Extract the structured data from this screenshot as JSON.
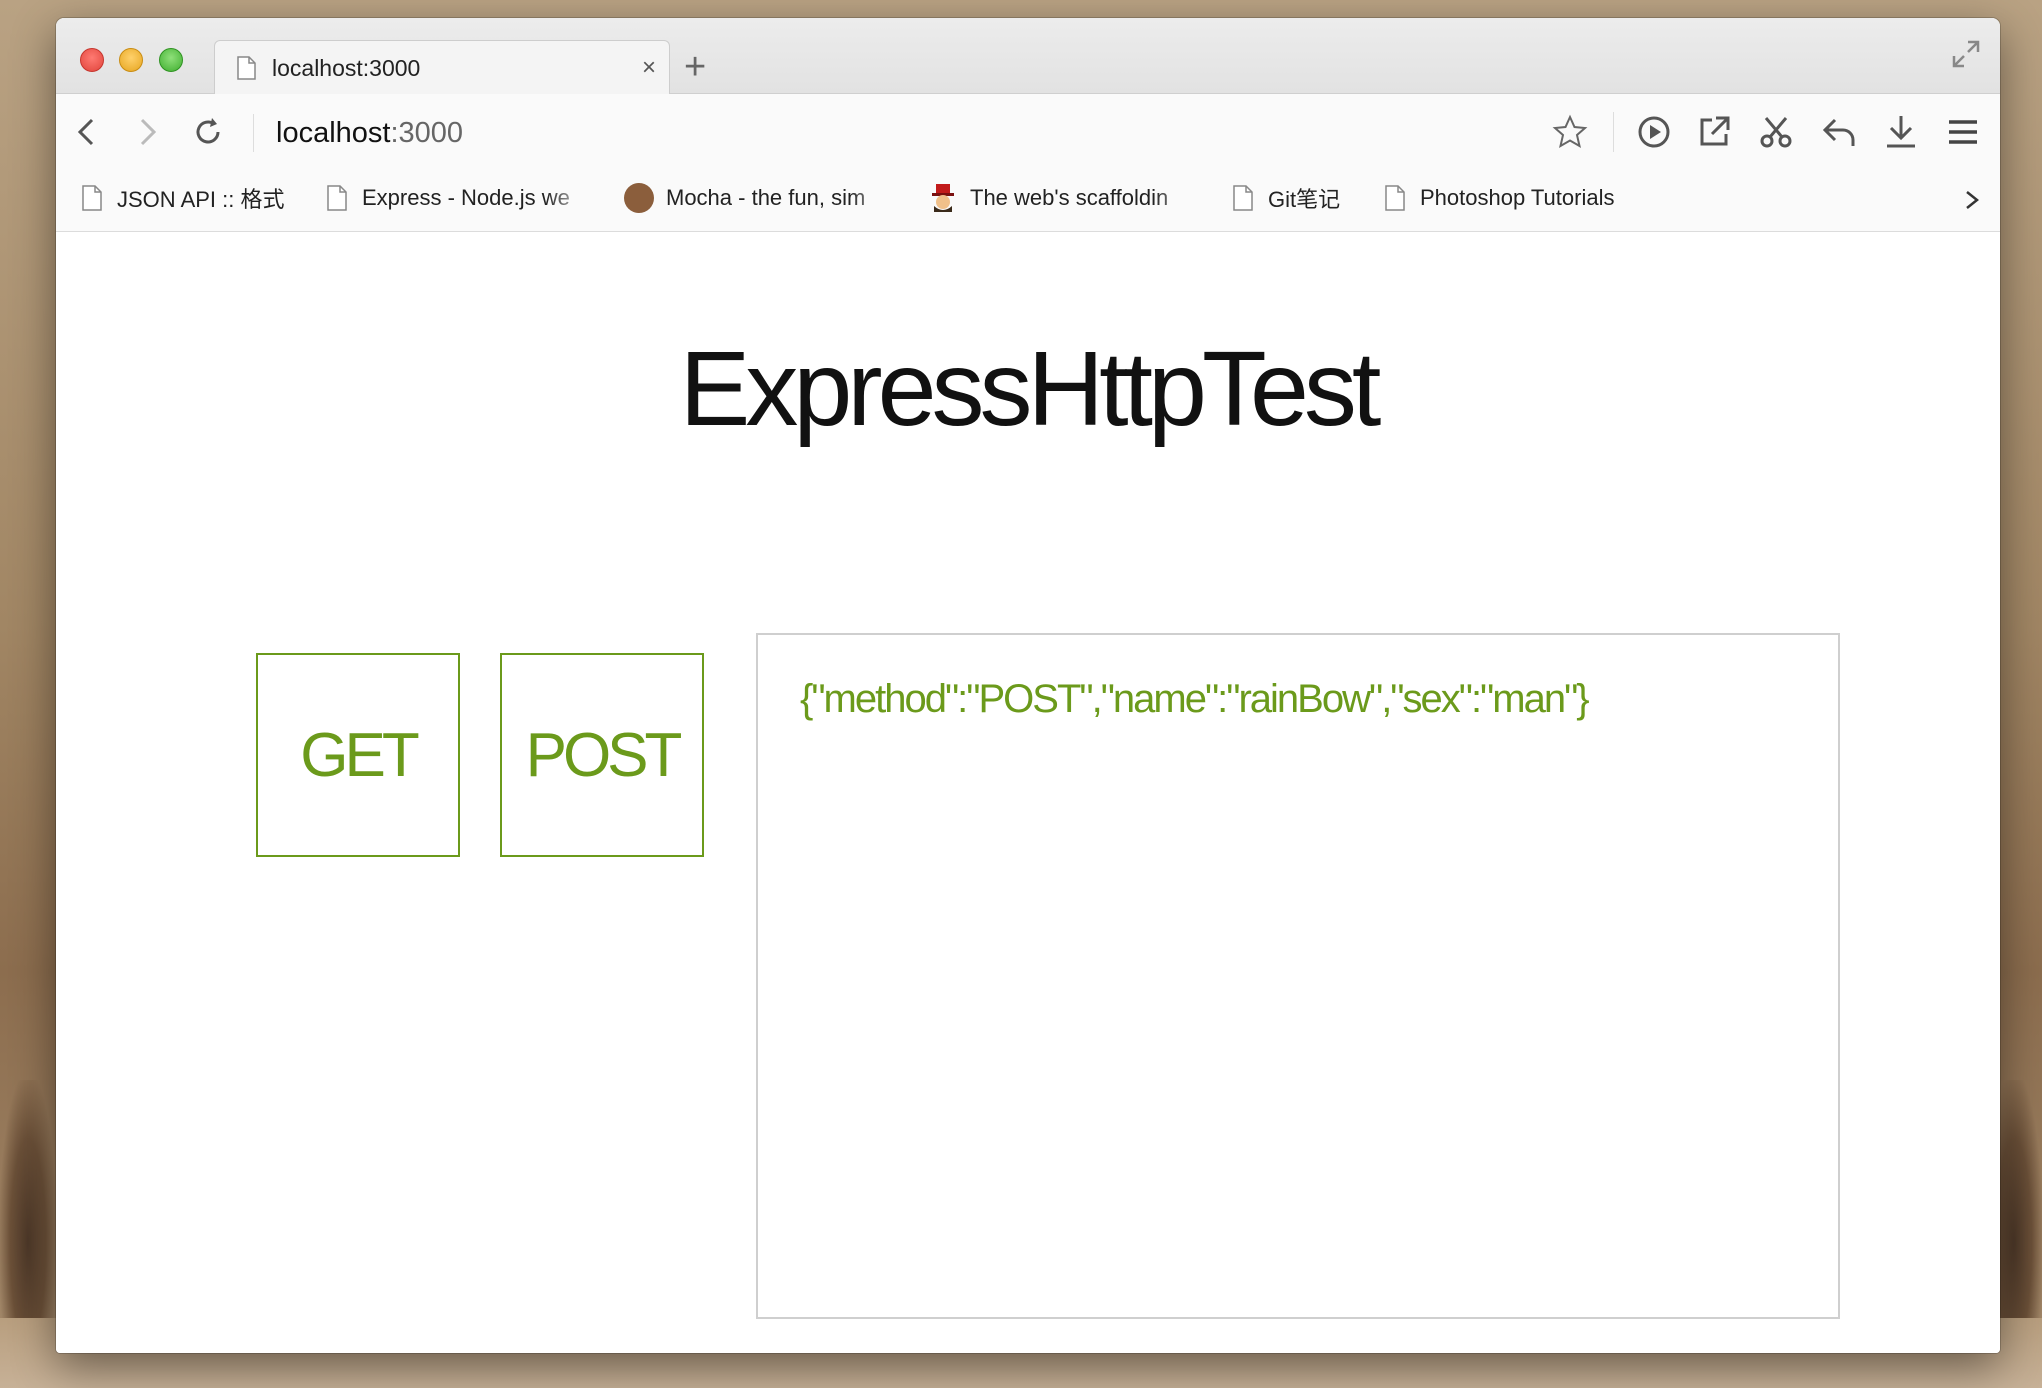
{
  "browser": {
    "tab": {
      "title": "localhost:3000",
      "close": "×"
    },
    "new_tab": "+",
    "address": {
      "host": "localhost",
      "port": ":3000"
    },
    "bookmarks": [
      {
        "label": "JSON API :: 格式",
        "icon": "page-icon"
      },
      {
        "label": "Express - Node.js we",
        "icon": "page-icon"
      },
      {
        "label": "Mocha - the fun, sim",
        "icon": "mocha-icon"
      },
      {
        "label": "The web's scaffoldin",
        "icon": "yeoman-icon"
      },
      {
        "label": "Git笔记",
        "icon": "page-icon"
      },
      {
        "label": "Photoshop Tutorials",
        "icon": "page-icon"
      }
    ]
  },
  "page": {
    "title": "ExpressHttpTest",
    "get_label": "GET",
    "post_label": "POST",
    "output": "{\"method\":\"POST\",\"name\":\"rainBow\",\"sex\":\"man\"}"
  },
  "colors": {
    "accent": "#6b9a1b",
    "output_border": "#cfcfcf"
  }
}
